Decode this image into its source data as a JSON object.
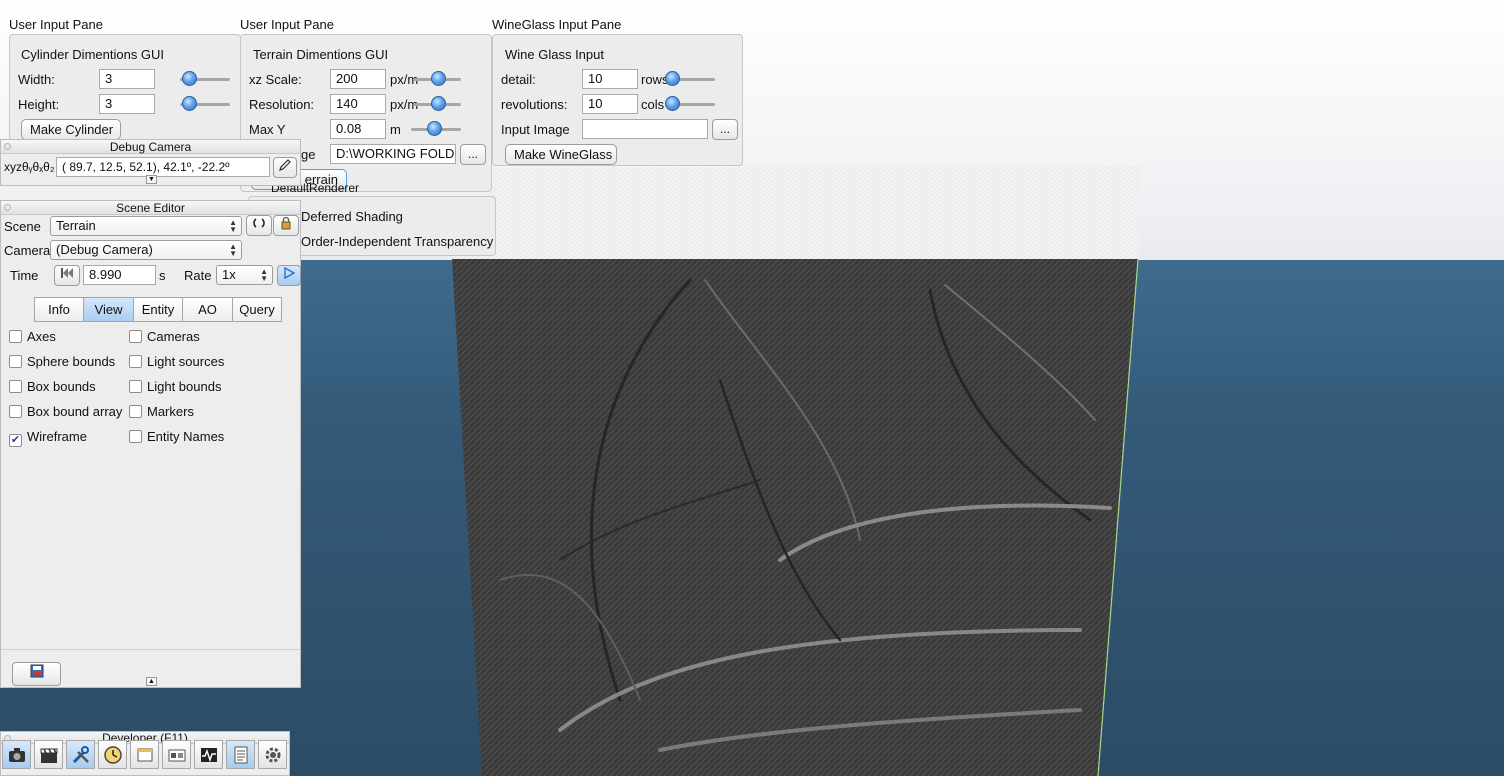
{
  "colors": {
    "accent": "#5ea2ea",
    "ground": "#345a79",
    "sky": "#f4f5f7",
    "panel": "#ececec"
  },
  "cylinder_pane": {
    "caption": "User Input Pane",
    "group_title": "Cylinder Dimentions GUI",
    "width_label": "Width:",
    "width_value": "3",
    "width_slider": 0.15,
    "height_label": "Height:",
    "height_value": "3",
    "height_slider": 0.15,
    "make_button": "Make Cylinder"
  },
  "terrain_pane": {
    "caption": "User Input Pane",
    "group_title": "Terrain Dimentions GUI",
    "xz_label": "xz Scale:",
    "xz_value": "200",
    "xz_unit": "px/m",
    "res_label": "Resolution:",
    "res_value": "140",
    "res_unit": "px/m",
    "maxy_label": "Max Y",
    "maxy_value": "0.08",
    "maxy_unit": "m",
    "image_label": "ge",
    "image_value": "D:\\WORKING FOLD",
    "browse": "...",
    "make_button": "errain"
  },
  "wineglass_pane": {
    "caption": "WineGlass Input Pane",
    "group_title": "Wine Glass Input",
    "detail_label": "detail:",
    "detail_value": "10",
    "detail_unit": "rows",
    "rev_label": "revolutions:",
    "rev_value": "10",
    "rev_unit": "cols",
    "image_label": "Input Image",
    "image_value": "",
    "browse": "...",
    "make_button": "Make WineGlass"
  },
  "renderer_pane": {
    "title": "DefaultRenderer",
    "deferred_label": "Deferred Shading",
    "oit_label": "Order-Independent Transparency"
  },
  "debug_camera": {
    "title": "Debug Camera",
    "prefix": "xyzθᵧθₓθ₂",
    "value": "( 89.7,  12.5,  52.1),  42.1º, -22.2º"
  },
  "scene_editor": {
    "title": "Scene Editor",
    "scene_label": "Scene",
    "scene_value": "Terrain",
    "camera_label": "Camera",
    "camera_value": "(Debug Camera)",
    "time_label": "Time",
    "time_value": "8.990",
    "time_unit": "s",
    "rate_label": "Rate",
    "rate_value": "1x",
    "tabs": [
      "Info",
      "View",
      "Entity",
      "AO",
      "Query"
    ],
    "active_tab": "View",
    "checkboxes_left": [
      {
        "label": "Axes",
        "checked": false
      },
      {
        "label": "Sphere bounds",
        "checked": false
      },
      {
        "label": "Box bounds",
        "checked": false
      },
      {
        "label": "Box bound array",
        "checked": false
      },
      {
        "label": "Wireframe",
        "checked": true
      }
    ],
    "checkboxes_right": [
      {
        "label": "Cameras",
        "checked": false
      },
      {
        "label": "Light sources",
        "checked": false
      },
      {
        "label": "Light bounds",
        "checked": false
      },
      {
        "label": "Markers",
        "checked": false
      },
      {
        "label": "Entity Names",
        "checked": false
      }
    ]
  },
  "developer": {
    "title": "Developer (F11)",
    "tools": [
      "camera-icon",
      "clapperboard-icon",
      "tools-icon",
      "clock-icon",
      "window-icon",
      "scene-icon",
      "profiler-icon",
      "log-icon",
      "settings-icon"
    ]
  }
}
